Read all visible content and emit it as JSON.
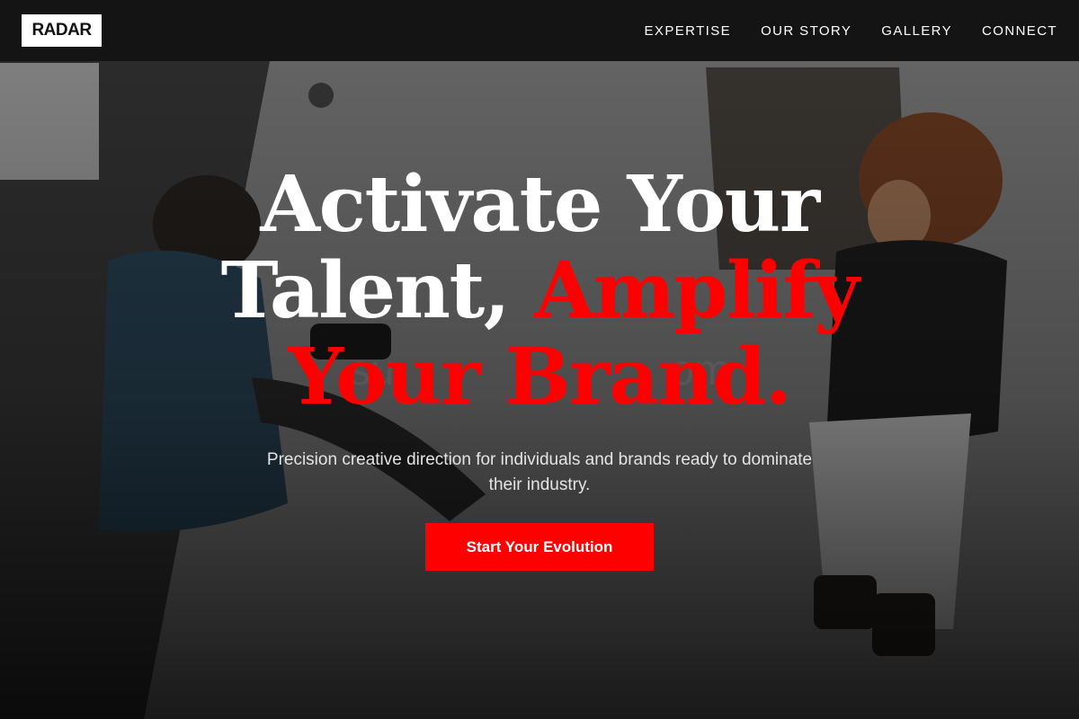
{
  "brand": {
    "logo_text": "RADAR"
  },
  "nav": {
    "items": [
      {
        "label": "EXPERTISE"
      },
      {
        "label": "OUR STORY"
      },
      {
        "label": "GALLERY"
      },
      {
        "label": "CONNECT"
      }
    ]
  },
  "hero": {
    "headline_line1": "Activate Your",
    "headline_line2_white": "Talent, ",
    "headline_line2_red": "Amplify",
    "headline_line3_red": "Your Brand.",
    "subtitle": "Precision creative direction for individuals and brands ready to dominate their industry.",
    "cta_label": "Start Your Evolution",
    "background_image": "photographer-and-model-photo"
  },
  "colors": {
    "accent": "#ff0000",
    "header_bg": "#141414",
    "text_primary": "#ffffff"
  }
}
